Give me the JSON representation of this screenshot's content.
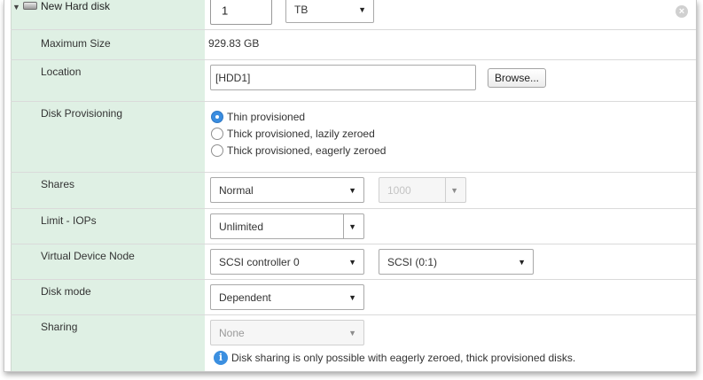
{
  "header": {
    "title": "New Hard disk",
    "size_value": "1",
    "size_unit": "TB"
  },
  "rows": {
    "max_size": {
      "label": "Maximum Size",
      "value": "929.83 GB"
    },
    "location": {
      "label": "Location",
      "value": "[HDD1]",
      "browse_label": "Browse..."
    },
    "provisioning": {
      "label": "Disk Provisioning",
      "options": [
        {
          "label": "Thin provisioned",
          "selected": true
        },
        {
          "label": "Thick provisioned, lazily zeroed",
          "selected": false
        },
        {
          "label": "Thick provisioned, eagerly zeroed",
          "selected": false
        }
      ]
    },
    "shares": {
      "label": "Shares",
      "value": "Normal",
      "amount": "1000"
    },
    "iops": {
      "label": "Limit - IOPs",
      "value": "Unlimited"
    },
    "vdn": {
      "label": "Virtual Device Node",
      "controller": "SCSI controller 0",
      "node": "SCSI (0:1)"
    },
    "disk_mode": {
      "label": "Disk mode",
      "value": "Dependent"
    },
    "sharing": {
      "label": "Sharing",
      "value": "None",
      "info": "Disk sharing is only possible with eagerly zeroed, thick provisioned disks."
    }
  },
  "colors": {
    "label_column": "#dff0e4",
    "radio_selected": "#3a8de0",
    "info_icon": "#3b8fe0"
  }
}
